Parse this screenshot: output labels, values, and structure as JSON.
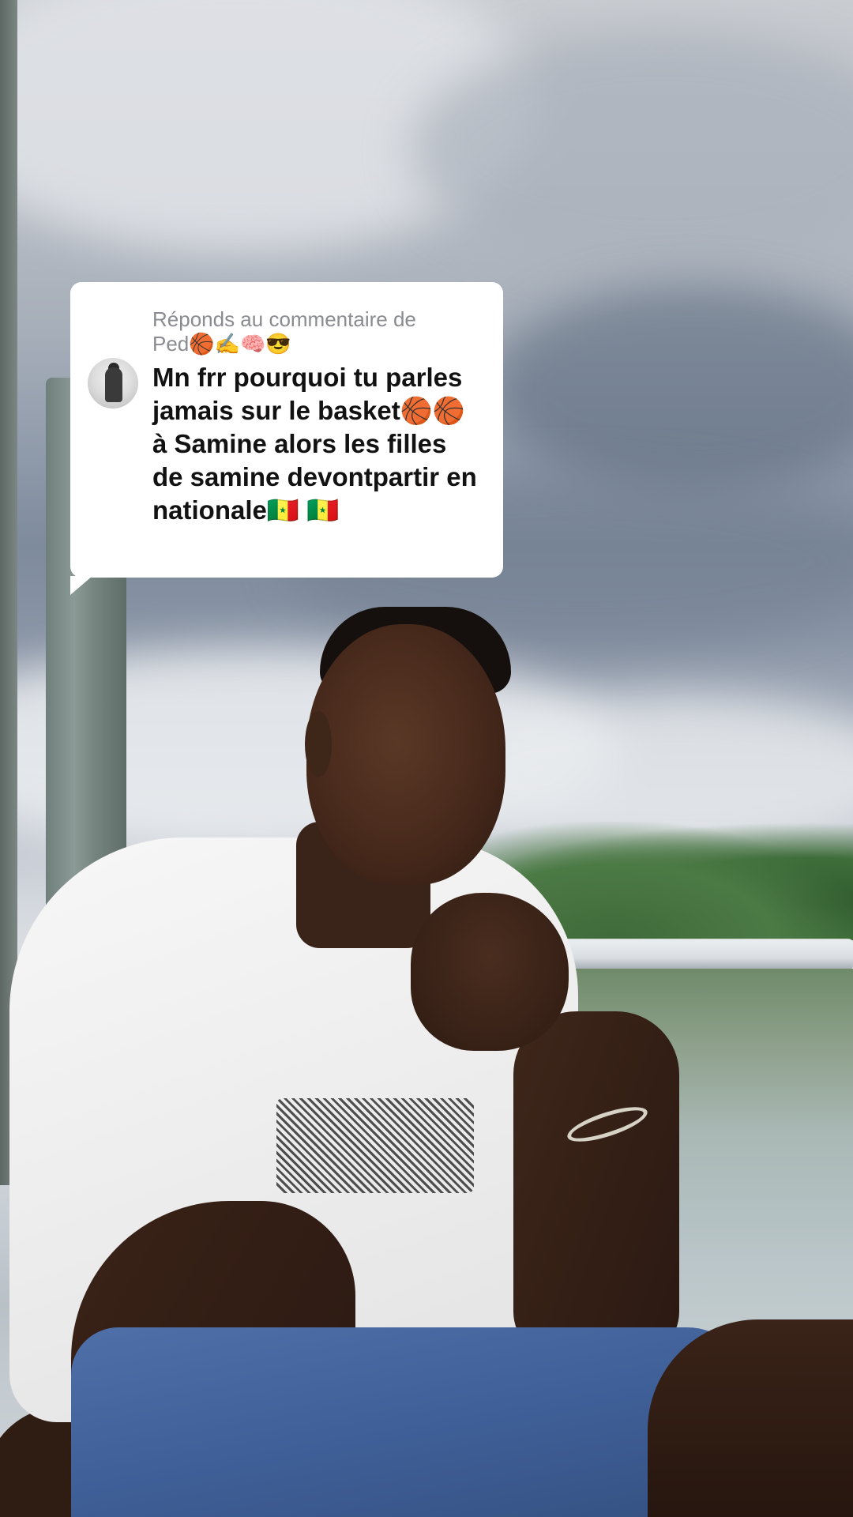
{
  "comment": {
    "reply_header": "Réponds au commentaire de",
    "username": "Ped🏀✍️🧠😎",
    "text": "Mn frr pourquoi tu parles jamais sur le basket🏀🏀 à Samine alors les filles de samine devontpartir en nationale🇸🇳 🇸🇳"
  },
  "colors": {
    "bubble_background": "#ffffff",
    "header_text": "#8a8b91",
    "comment_text": "#121212"
  },
  "icons": {
    "avatar": "commenter-avatar"
  }
}
